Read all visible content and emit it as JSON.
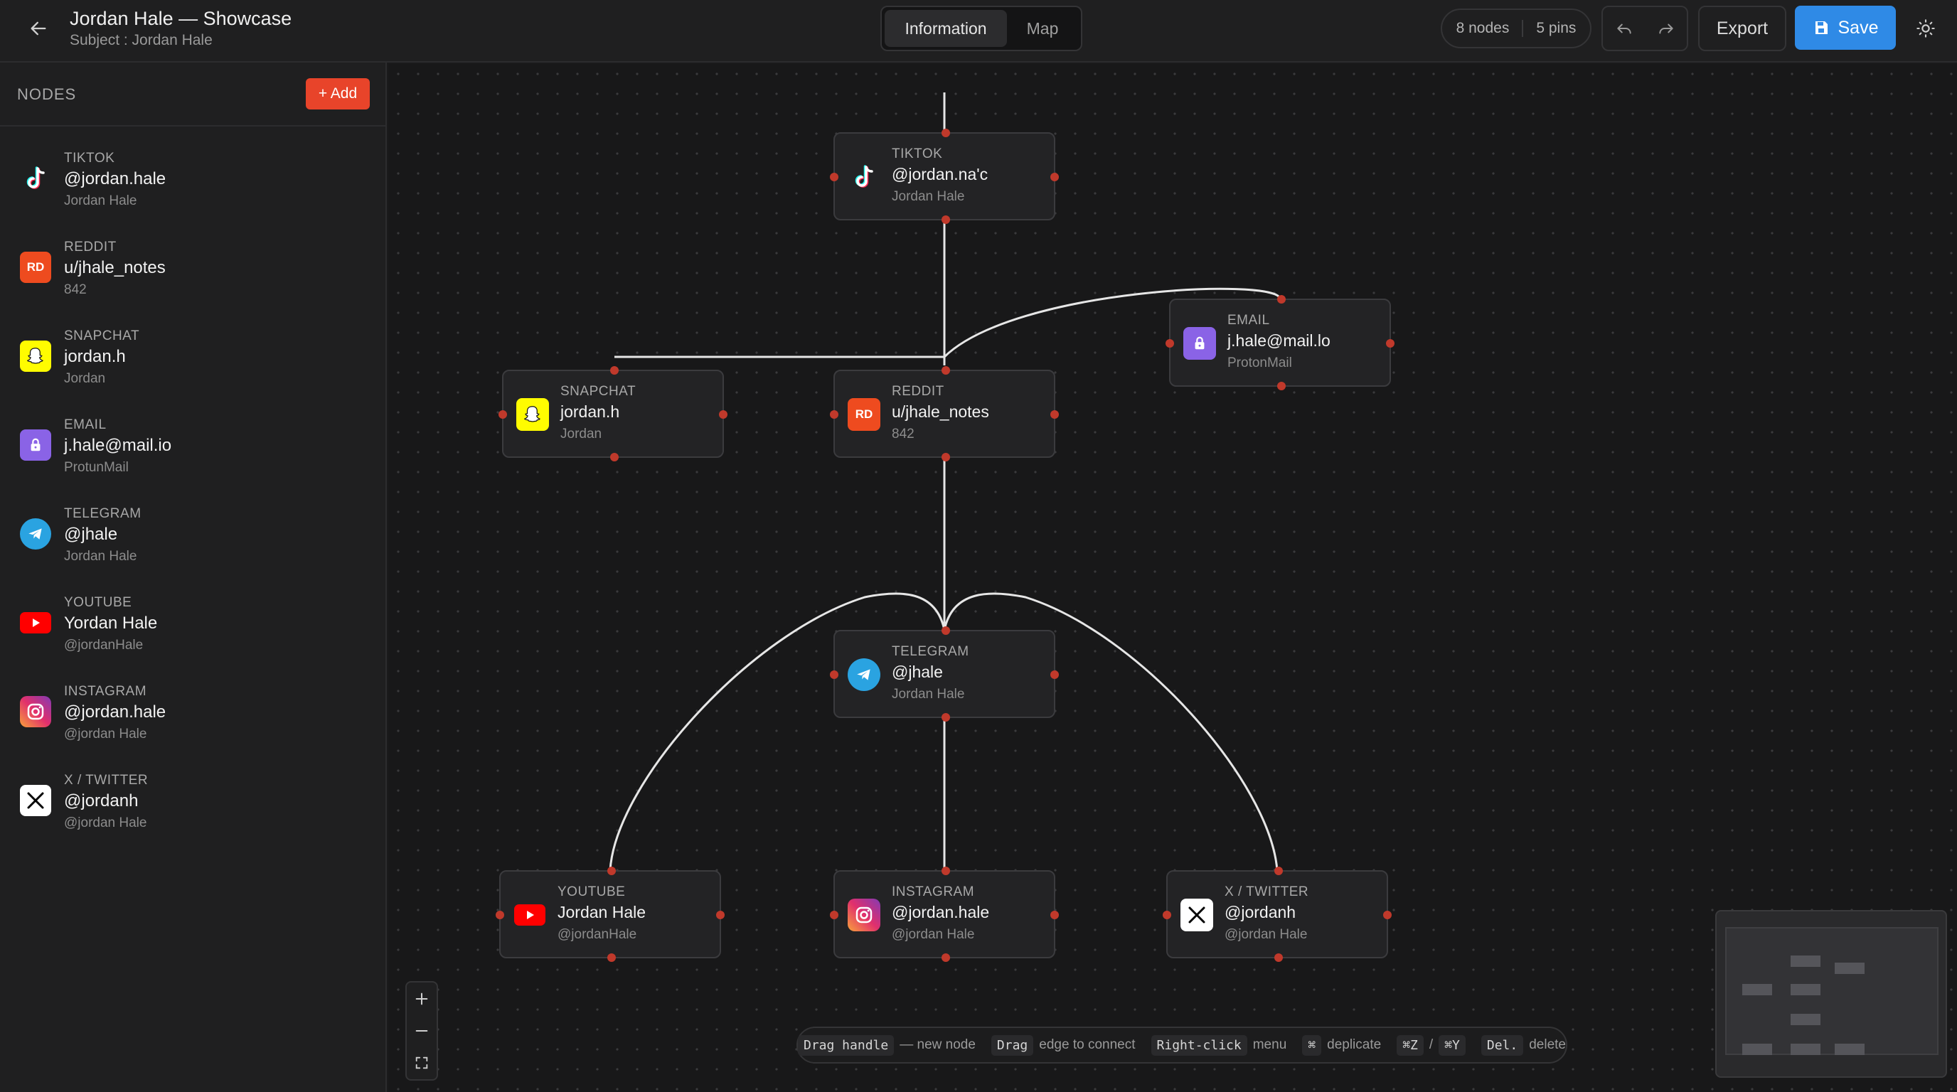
{
  "header": {
    "title": "Jordan Hale — Showcase",
    "subtitle": "Subject : Jordan Hale",
    "tabs": [
      {
        "label": "Information",
        "active": true
      },
      {
        "label": "Map",
        "active": false
      }
    ],
    "counts": {
      "nodes": "8 nodes",
      "pins": "5 pins"
    },
    "export_label": "Export",
    "save_label": "Save"
  },
  "sidebar": {
    "heading": "NODES",
    "add_label": "+ Add",
    "items": [
      {
        "platform": "TIKTOK",
        "handle": "@jordan.hale",
        "sub": "Jordan Hale",
        "icon": "tiktok-icon"
      },
      {
        "platform": "REDDIT",
        "handle": "u/jhale_notes",
        "sub": "842",
        "icon": "reddit-icon",
        "badge": "RD"
      },
      {
        "platform": "SNAPCHAT",
        "handle": "jordan.h",
        "sub": "Jordan",
        "icon": "snapchat-icon"
      },
      {
        "platform": "EMAIL",
        "handle": "j.hale@mail.io",
        "sub": "ProtunMail",
        "icon": "lock-icon"
      },
      {
        "platform": "TELEGRAM",
        "handle": "@jhale",
        "sub": "Jordan Hale",
        "icon": "telegram-icon"
      },
      {
        "platform": "YOUTUBE",
        "handle": "Yordan Hale",
        "sub": "@jordanHale",
        "icon": "youtube-icon"
      },
      {
        "platform": "INSTAGRAM",
        "handle": "@jordan.hale",
        "sub": "@jordan Hale",
        "icon": "instagram-icon"
      },
      {
        "platform": "X / TWITTER",
        "handle": "@jordanh",
        "sub": "@jordan Hale",
        "icon": "x-icon"
      }
    ]
  },
  "nodes": {
    "tiktok": {
      "platform": "TIKTOK",
      "handle": "@jordan.na'c",
      "sub": "Jordan Hale"
    },
    "email": {
      "platform": "EMAIL",
      "handle": "j.hale@mail.lo",
      "sub": "ProtonMail"
    },
    "snapchat": {
      "platform": "SNAPCHAT",
      "handle": "jordan.h",
      "sub": "Jordan"
    },
    "reddit": {
      "platform": "REDDIT",
      "handle": "u/jhale_notes",
      "sub": "842",
      "badge": "RD"
    },
    "telegram": {
      "platform": "TELEGRAM",
      "handle": "@jhale",
      "sub": "Jordan Hale"
    },
    "youtube": {
      "platform": "YOUTUBE",
      "handle": "Jordan Hale",
      "sub": "@jordanHale"
    },
    "instagram": {
      "platform": "INSTAGRAM",
      "handle": "@jordan.hale",
      "sub": "@jordan Hale"
    },
    "twitter": {
      "platform": "X / TWITTER",
      "handle": "@jordanh",
      "sub": "@jordan Hale"
    }
  },
  "hints": {
    "k1": "Drag handle",
    "t1": "— new node",
    "k2": "Drag",
    "t2": "edge to connect",
    "k3": "Right-click",
    "t3": "menu",
    "k4": "⌘",
    "t4": "deplicate",
    "k5": "⌘Z",
    "t5": "/",
    "k6": "⌘Y",
    "k7": "Del.",
    "t7": "delete"
  },
  "colors": {
    "accent": "#2f8ae6",
    "add": "#e8442a",
    "pin": "#c0392b",
    "reddit": "#ee4b1f",
    "snapchat": "#fffc00",
    "email": "#8a63e6",
    "telegram": "#2aa3e1",
    "youtube": "#ff0000"
  }
}
